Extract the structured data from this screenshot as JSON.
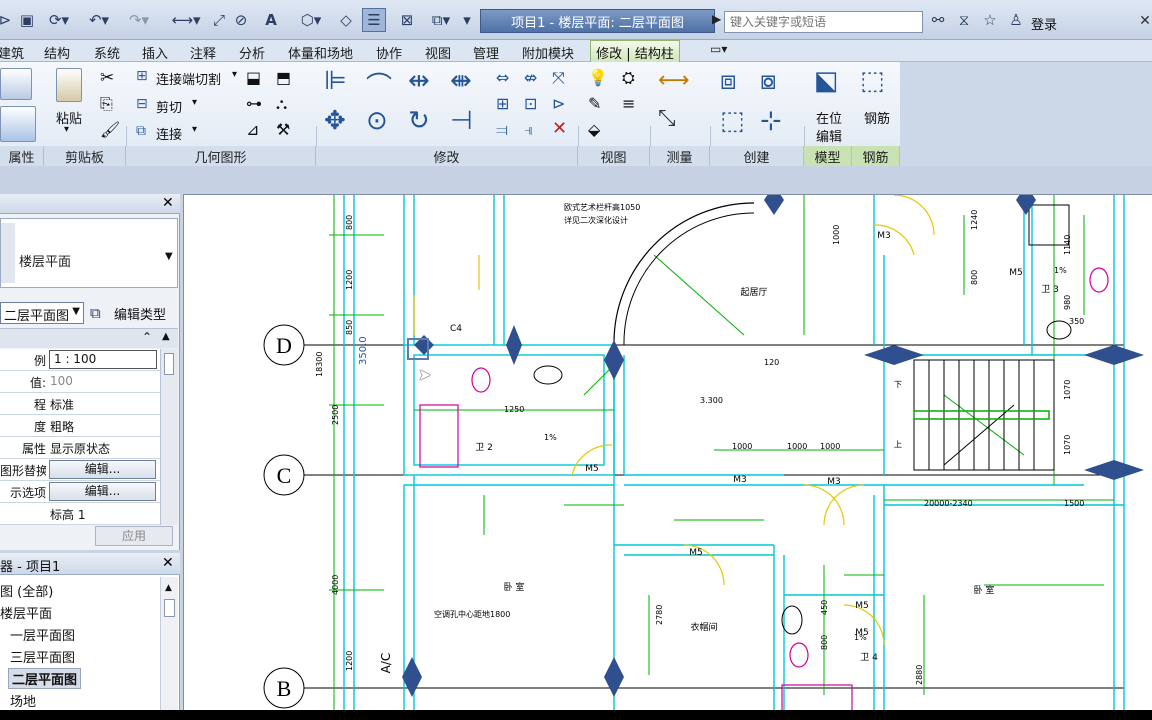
{
  "window": {
    "title": "项目1 - 楼层平面: 二层平面图",
    "search_placeholder": "键入关键字或短语",
    "login": "登录"
  },
  "tabs": [
    "建筑",
    "结构",
    "系统",
    "插入",
    "注释",
    "分析",
    "体量和场地",
    "协作",
    "视图",
    "管理",
    "附加模块"
  ],
  "active_tab": "修改 | 结构柱",
  "ribbon": {
    "panels": [
      "属性",
      "剪贴板",
      "几何图形",
      "修改",
      "视图",
      "测量",
      "创建",
      "模型",
      "钢筋"
    ],
    "paste": "粘贴",
    "cut_join": "连接端切割",
    "cut": "剪切",
    "join": "连接",
    "in_place_edit_1": "在位",
    "in_place_edit_2": "编辑",
    "rebar": "钢筋"
  },
  "properties": {
    "type_name": "楼层平面",
    "view_select": "二层平面图",
    "edit_type": "编辑类型",
    "rows": [
      {
        "k": "例",
        "v": "1 : 100"
      },
      {
        "k": "值:",
        "v": "100"
      },
      {
        "k": "程",
        "v": "标准"
      },
      {
        "k": "度",
        "v": "粗略"
      },
      {
        "k": "属性",
        "v": "显示原状态"
      },
      {
        "k": "图形替换",
        "v": "编辑..."
      },
      {
        "k": "示选项",
        "v": "编辑..."
      },
      {
        "k": "",
        "v": "标高 1"
      }
    ],
    "apply": "应用"
  },
  "browser": {
    "title": "器 - 项目1",
    "items": [
      "图 (全部)",
      "楼层平面",
      "一层平面图",
      "三层平面图",
      "二层平面图",
      "场地"
    ]
  },
  "drawing": {
    "grid_labels": [
      "D",
      "C",
      "B"
    ],
    "dims": [
      "800",
      "1200",
      "850",
      "18300",
      "2500",
      "4000",
      "1200",
      "1000",
      "1240",
      "800",
      "1140",
      "980",
      "1070",
      "1070",
      "2780",
      "2880",
      "800",
      "450",
      "350.0",
      "350"
    ],
    "rooms": [
      "起居厅",
      "卫 2",
      "卧 室",
      "卧 室",
      "衣帽间",
      "卫 3",
      "卫 4"
    ],
    "tags": [
      "C4",
      "M5",
      "M3",
      "M3",
      "M3",
      "M5",
      "M5",
      "M5",
      "M5",
      "A/C"
    ],
    "notes": [
      "欧式艺术栏杆高1050",
      "详见二次深化设计",
      "3.300",
      "1%",
      "1%",
      "1%",
      "上",
      "下",
      "空调孔中心距地1800",
      "120",
      "1250",
      "1000",
      "1000",
      "1000",
      "20000-2340",
      "1500"
    ]
  },
  "colors": {
    "accent": "#4f71a6",
    "active_tab": "#cfe6b6",
    "wall_cyan": "#00c8d6",
    "dim_green": "#00b000"
  }
}
